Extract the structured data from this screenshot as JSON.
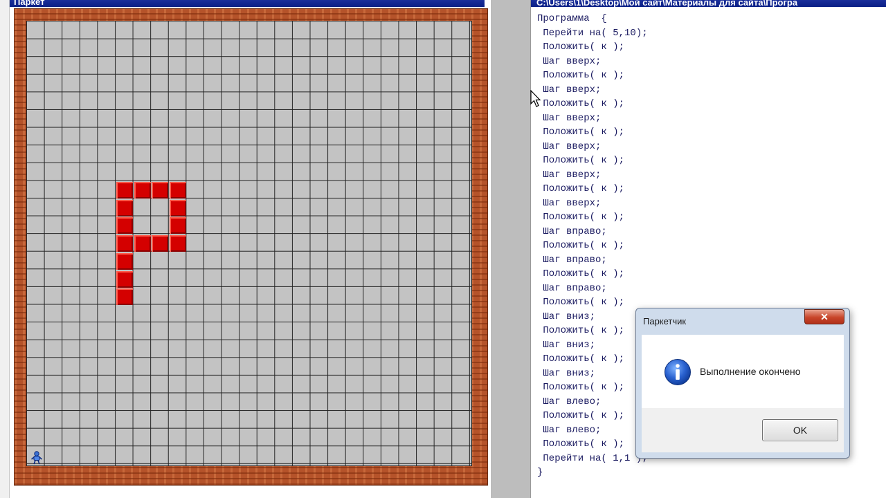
{
  "left_window": {
    "title": "Паркет",
    "grid": {
      "columns": 25,
      "rows": 25,
      "tiles": [
        {
          "col": 5,
          "row": 9
        },
        {
          "col": 6,
          "row": 9
        },
        {
          "col": 7,
          "row": 9
        },
        {
          "col": 8,
          "row": 9
        },
        {
          "col": 5,
          "row": 10
        },
        {
          "col": 8,
          "row": 10
        },
        {
          "col": 5,
          "row": 11
        },
        {
          "col": 8,
          "row": 11
        },
        {
          "col": 5,
          "row": 12
        },
        {
          "col": 6,
          "row": 12
        },
        {
          "col": 7,
          "row": 12
        },
        {
          "col": 8,
          "row": 12
        },
        {
          "col": 5,
          "row": 13
        },
        {
          "col": 5,
          "row": 14
        },
        {
          "col": 5,
          "row": 15
        }
      ],
      "tile_color": "#d40000"
    },
    "robot_icon": "robot-icon"
  },
  "right_window": {
    "title": "C:\\Users\\1\\Desktop\\Мой сайт\\Материалы для сайта\\Програ",
    "code_lines": [
      "Программа  {",
      " Перейти на( 5,10);",
      " Положить( к );",
      " Шаг вверх;",
      " Положить( к );",
      " Шаг вверх;",
      " Положить( к );",
      " Шаг вверх;",
      " Положить( к );",
      " Шаг вверх;",
      " Положить( к );",
      " Шаг вверх;",
      " Положить( к );",
      " Шаг вверх;",
      " Положить( к );",
      " Шаг вправо;",
      " Положить( к );",
      " Шаг вправо;",
      " Положить( к );",
      " Шаг вправо;",
      " Положить( к );",
      " Шаг вниз;",
      " Положить( к );",
      " Шаг вниз;",
      " Положить( к );",
      " Шаг вниз;",
      " Положить( к );",
      " Шаг влево;",
      " Положить( к );",
      " Шаг влево;",
      " Положить( к );",
      " Перейти на( 1,1 );",
      "}"
    ]
  },
  "dialog": {
    "title": "Паркетчик",
    "close_label": "✕",
    "message": "Выполнение окончено",
    "ok_label": "OK",
    "icon": "info-icon"
  },
  "colors": {
    "titlebar": "#0a1f86",
    "grid_bg": "#c3c3c3",
    "frame_brick": "#b5532a",
    "tile": "#d40000"
  }
}
